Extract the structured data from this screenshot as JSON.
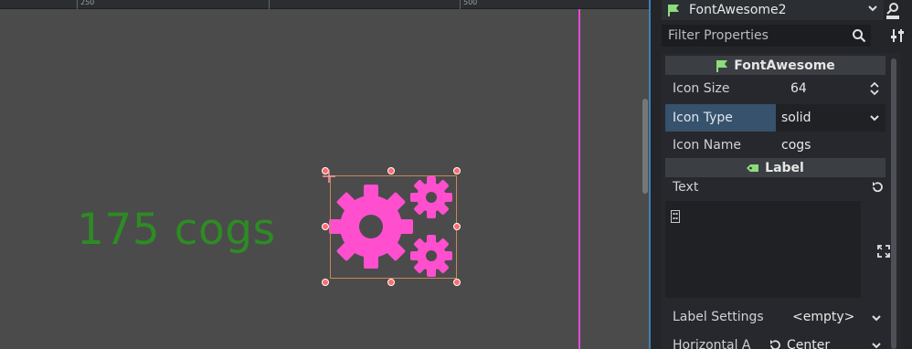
{
  "ruler": {
    "ticks": [
      "250",
      "500"
    ]
  },
  "canvas": {
    "label_text": "175 cogs"
  },
  "inspector": {
    "node_name": "FontAwesome2",
    "filter_placeholder": "Filter Properties",
    "sections": {
      "fontawesome": "FontAwesome",
      "label": "Label"
    },
    "properties": {
      "icon_size": {
        "label": "Icon Size",
        "value": "64"
      },
      "icon_type": {
        "label": "Icon Type",
        "value": "solid"
      },
      "icon_name": {
        "label": "Icon Name",
        "value": "cogs"
      },
      "text": {
        "label": "Text",
        "value": ""
      },
      "label_settings": {
        "label": "Label Settings",
        "value": "<empty>"
      },
      "horizontal_alignment": {
        "label": "Horizontal A",
        "value": "Center"
      }
    }
  },
  "colors": {
    "accent_flag": "#8edb7c",
    "icon_pink": "#ff4fcf",
    "label_green": "#2e8b24",
    "guide_line": "#e64bdc"
  },
  "icons": [
    "node-flag-icon",
    "chevron-down-icon",
    "doc-search-icon",
    "search-icon",
    "tools-icon",
    "label-tag-icon",
    "revert-icon",
    "expand-icon",
    "stepper-icon"
  ]
}
